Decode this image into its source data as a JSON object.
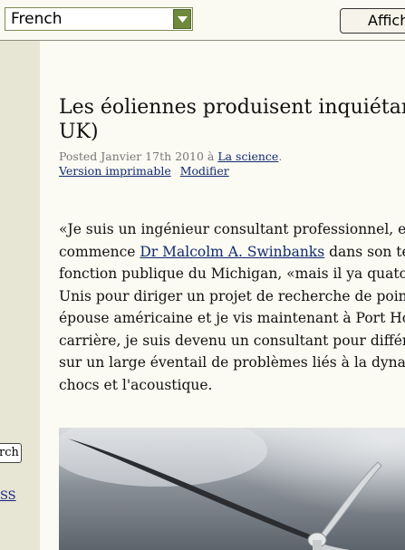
{
  "translate_bar": {
    "language_value": "French",
    "show_button_label": "Affich"
  },
  "sidebar": {
    "search_button_label": "rch",
    "rss_link": "SS"
  },
  "post": {
    "title_line1": "Les éoliennes produisent inquiétant b",
    "title_line2": "UK)",
    "meta_prefix": "Posted Janvier 17th 2010 à ",
    "category_link": "La science",
    "meta_suffix": ".",
    "print_link": "Version imprimable",
    "edit_link": "Modifier",
    "body": {
      "line1": "«Je suis un ingénieur consultant professionnel, et n",
      "line2_before": "commence ",
      "author_link": "Dr Malcolm A. Swinbanks",
      "line2_after": " dans son tém",
      "line3": "fonction publique du Michigan, «mais il ya quatorz",
      "line4": "Unis pour diriger un projet de recherche de pointe",
      "line5": "épouse américaine et je vis maintenant à Port Hope",
      "line6": "carrière, je suis devenu un consultant pour différen",
      "line7": "sur un large éventail de problèmes liés à la dynamic",
      "line8": "chocs et l'acoustique."
    }
  },
  "colors": {
    "page_bg": "#f3f2e5",
    "content_bg": "#fbfaf3",
    "link": "#102a6e",
    "select_arrow": "#6f8a3b"
  }
}
